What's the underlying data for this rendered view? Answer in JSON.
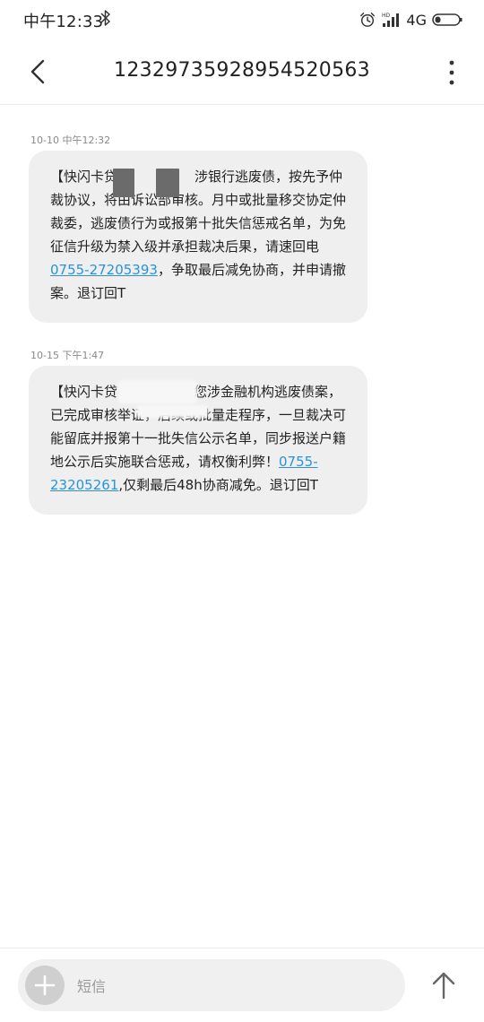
{
  "status_bar": {
    "time": "中午12:33",
    "network": "4G"
  },
  "icons": {
    "bluetooth": "bluetooth-icon",
    "alarm": "alarm-icon",
    "signal": "signal-icon",
    "battery": "battery-icon",
    "back": "back-arrow-icon",
    "more": "more-vertical-icon",
    "add": "plus-icon",
    "send": "send-arrow-icon"
  },
  "header": {
    "title": "12329735928954520563"
  },
  "messages": [
    {
      "timestamp": "10-10 中午12:32",
      "text_1": "【快闪卡贷",
      "text_2": "涉银行逃废债，按先予仲裁协议，将由诉讼部审核。月中或批量移交协定仲裁委，逃废债行为或报第十批失信惩戒名单，为免征信升级为禁入级并承担裁决后果，请速回电",
      "phone": "0755-27205393",
      "text_3": "，争取最后减免协商，并申请撤案。退订回T"
    },
    {
      "timestamp": "10-15 下午1:47",
      "text_1": "【快闪卡贷",
      "text_2": "于您涉金融机构逃废债案，已完成审核举证，后续或批量走程序，一旦裁决可能留底并报第十一批失信公示名单，同步报送户籍地公示后实施联合惩戒，请权衡利弊！",
      "phone": "0755-23205261",
      "text_3": ",仅剩最后48h协商减免。退订回T"
    }
  ],
  "input_bar": {
    "placeholder": "短信"
  },
  "colors": {
    "link": "#2a93d8",
    "bubble": "#efefef",
    "meta_text": "#8a8a8a"
  }
}
